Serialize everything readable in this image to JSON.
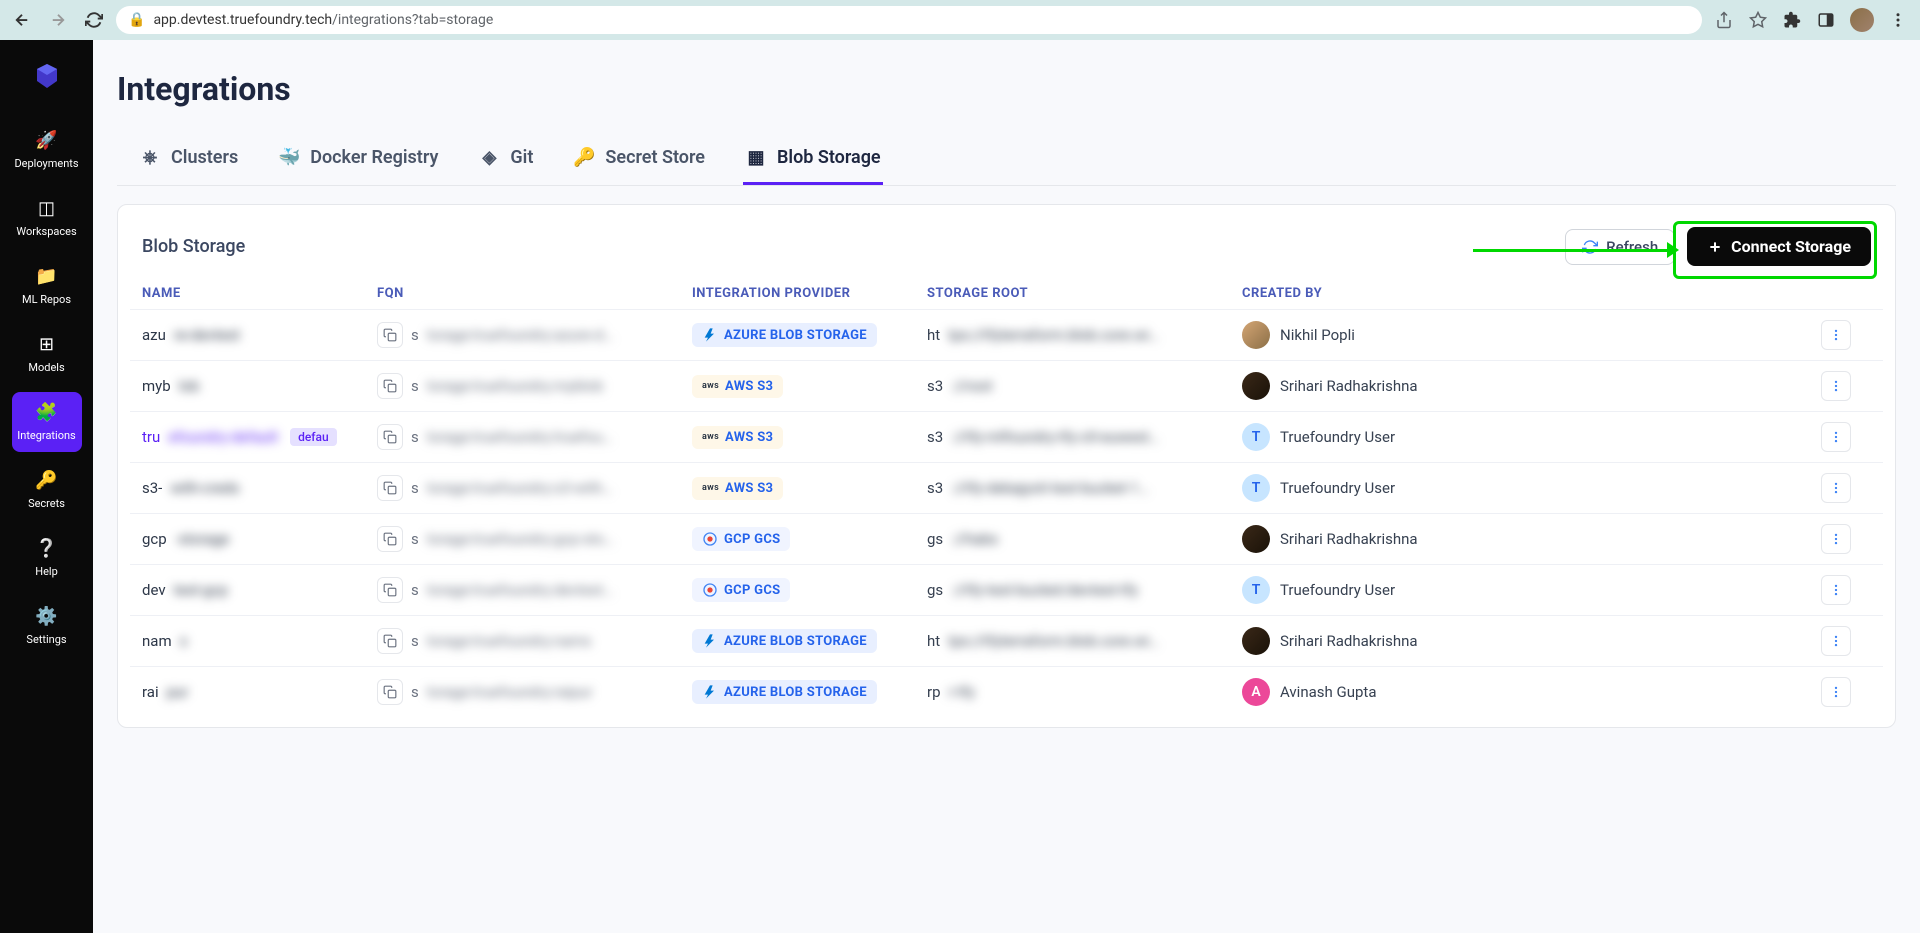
{
  "browser": {
    "url_host": "app.devtest.truefoundry.tech",
    "url_path": "/integrations?tab=storage"
  },
  "sidebar": {
    "deployments": "Deployments",
    "workspaces": "Workspaces",
    "mlrepos": "ML Repos",
    "models": "Models",
    "integrations": "Integrations",
    "secrets": "Secrets",
    "help": "Help",
    "settings": "Settings"
  },
  "page": {
    "title": "Integrations"
  },
  "tabs": {
    "clusters": "Clusters",
    "docker": "Docker Registry",
    "git": "Git",
    "secret": "Secret Store",
    "blob": "Blob Storage"
  },
  "card": {
    "title": "Blob Storage",
    "refresh": "Refresh",
    "connect": "Connect Storage"
  },
  "columns": {
    "name": "NAME",
    "fqn": "FQN",
    "provider": "INTEGRATION PROVIDER",
    "root": "STORAGE ROOT",
    "created": "CREATED BY"
  },
  "providers": {
    "azure": "AZURE BLOB STORAGE",
    "aws": "AWS S3",
    "gcp": "GCP GCS"
  },
  "rows": [
    {
      "name": "azure-devtest",
      "fqn": "storage:truefoundry:azure-d…",
      "provider": "azure",
      "root": "https://tfyterraform.blob.core.wi…",
      "user": "Nikhil Popli",
      "avatar": "img1"
    },
    {
      "name": "myblob",
      "fqn": "storage:truefoundry:myblob",
      "provider": "aws",
      "root": "s3://root",
      "user": "Srihari Radhakrishna",
      "avatar": "img2"
    },
    {
      "name": "truefoundry-default",
      "link": true,
      "badge": "defau",
      "fqn": "storage:truefoundry:truefou…",
      "provider": "aws",
      "root": "s3://tfy-mlfoundry-tfy-ctl-euwest…",
      "user": "Truefoundry User",
      "avatar": "T"
    },
    {
      "name": "s3-with-creds",
      "fqn": "storage:truefoundry:s3-with…",
      "provider": "aws",
      "root": "s3://tfy-debajyoti-test-bucket-1…",
      "user": "Truefoundry User",
      "avatar": "T"
    },
    {
      "name": "gcp-storage",
      "fqn": "storage:truefoundry:gcp-sto…",
      "provider": "gcp",
      "root": "gs://habs",
      "user": "Srihari Radhakrishna",
      "avatar": "img2"
    },
    {
      "name": "devtest-gcp",
      "fqn": "storage:truefoundry:devtest…",
      "provider": "gcp",
      "root": "gs://tfy-test-bucket/devtest-tfy",
      "user": "Truefoundry User",
      "avatar": "T"
    },
    {
      "name": "nams",
      "fqn": "storage:truefoundry:nams",
      "provider": "azure",
      "root": "https://tfyterraform.blob.core.wi…",
      "user": "Srihari Radhakrishna",
      "avatar": "img2"
    },
    {
      "name": "raipur",
      "fqn": "storage:truefoundry:raipur",
      "provider": "azure",
      "root": "rpr-tfy",
      "user": "Avinash Gupta",
      "avatar": "A"
    }
  ]
}
